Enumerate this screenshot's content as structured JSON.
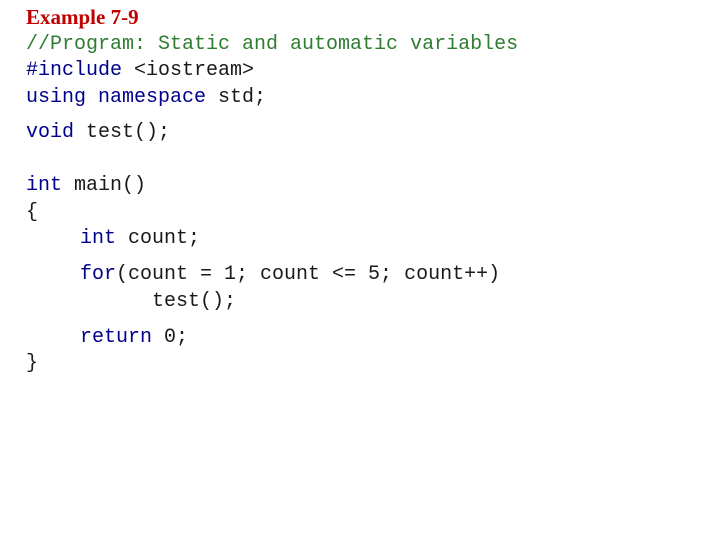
{
  "title": "Example 7-9",
  "lines": {
    "comment": "//Program: Static and automatic variables",
    "include_kw": "#include",
    "include_rest": " <iostream>",
    "using_kw": "using namespace",
    "using_rest": " std;",
    "void_kw": "void",
    "void_rest": " test();",
    "int_kw": "int",
    "main_rest": " main()",
    "open_brace": "{",
    "count_kw": "int",
    "count_rest": " count;",
    "for_kw": "for",
    "for_rest": "(count = 1; count <= 5; count++)",
    "call": "test();",
    "return_kw": "return",
    "return_rest": " 0;",
    "close_brace": "}"
  }
}
